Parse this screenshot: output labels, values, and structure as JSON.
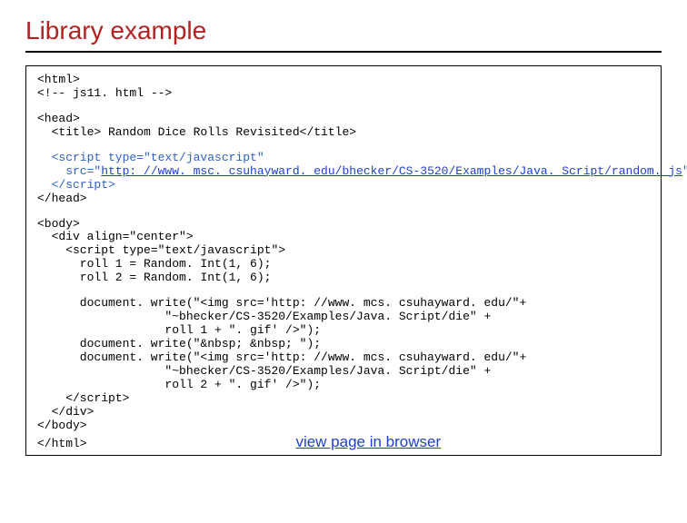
{
  "title": "Library example",
  "code": {
    "l1": "<html>",
    "l2": "<!-- js11. html -->",
    "l3": "<head>",
    "l4": "<title> Random Dice Rolls Revisited</title>",
    "s1": "<script type=\"text/javascript\"",
    "s2a": "src=\"",
    "s2url": "http: //www. msc. csuhayward. edu/bhecker/CS-3520/Examples/Java. Script/random. js",
    "s2b": "\">",
    "s3": "</script>",
    "l5": "</head>",
    "b1": "<body>",
    "b2": "<div align=\"center\">",
    "b3": "<script type=\"text/javascript\">",
    "b4": "roll 1 = Random. Int(1, 6);",
    "b5": "roll 2 = Random. Int(1, 6);",
    "d1": "document. write(\"<img src='http: //www. mcs. csuhayward. edu/\"+",
    "d2": "\"~bhecker/CS-3520/Examples/Java. Script/die\" +",
    "d3": "roll 1 + \". gif' />\");",
    "d4": "document. write(\"&nbsp; &nbsp; \");",
    "d5": "document. write(\"<img src='http: //www. mcs. csuhayward. edu/\"+",
    "d6": "\"~bhecker/CS-3520/Examples/Java. Script/die\" +",
    "d7": "roll 2 + \". gif' />\");",
    "c1": "</script>",
    "c2": "</div>",
    "c3": "</body>",
    "c4": "</html>"
  },
  "view_link_label": "view page in browser"
}
